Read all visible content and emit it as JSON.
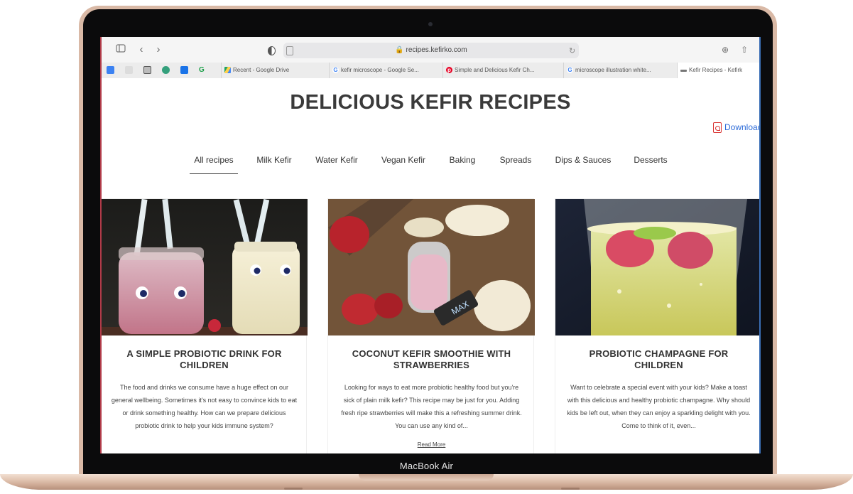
{
  "device": {
    "label": "MacBook Air"
  },
  "browser": {
    "url": "recipes.kefirko.com",
    "tabs": [
      {
        "label": "Recent - Google Drive",
        "icon": "google-drive-icon"
      },
      {
        "label": "kefir microscope - Google Se...",
        "icon": "google-icon"
      },
      {
        "label": "Simple and Delicious Kefir Ch...",
        "icon": "pinterest-icon"
      },
      {
        "label": "microscope illustration white...",
        "icon": "google-icon"
      },
      {
        "label": "Kefir Recipes - Kefirk",
        "icon": "kefirko-icon"
      }
    ],
    "bookmarks": [
      "calendar-icon",
      "bookmark-icon",
      "sheet-icon",
      "chat-icon",
      "trello-icon",
      "grammarly-icon"
    ]
  },
  "page": {
    "title": "DELICIOUS KEFIR RECIPES",
    "download_label": "Download",
    "nav": [
      "All recipes",
      "Milk Kefir",
      "Water Kefir",
      "Vegan Kefir",
      "Baking",
      "Spreads",
      "Dips & Sauces",
      "Desserts"
    ],
    "active_nav": "All recipes"
  },
  "cards": [
    {
      "title": "A SIMPLE PROBIOTIC DRINK FOR CHILDREN",
      "text": "The food and drinks we consume have a huge effect on our general wellbeing. Sometimes it's not easy to convince kids to eat or drink something healthy. How can we prepare delicious probiotic drink to help your kids immune system?",
      "read_more": ""
    },
    {
      "title": "COCONUT KEFIR SMOOTHIE WITH STRAWBERRIES",
      "text": "Looking for ways to eat more probiotic healthy food but you're sick of plain milk kefir? This recipe may be just for you. Adding fresh ripe strawberries will make this a refreshing summer drink. You can use any kind of...",
      "read_more": "Read More"
    },
    {
      "title": "PROBIOTIC CHAMPAGNE FOR CHILDREN",
      "text": "Want to celebrate a special event with your kids? Make a toast with this delicious and healthy probiotic champagne. Why should kids be left out, when they can enjoy a sparkling delight with you. Come to think of it, even...",
      "read_more": ""
    }
  ],
  "colors": {
    "accent_link": "#2d6bd8",
    "title": "#3a3a3a",
    "laptop_gold": "#d9b9a6"
  }
}
